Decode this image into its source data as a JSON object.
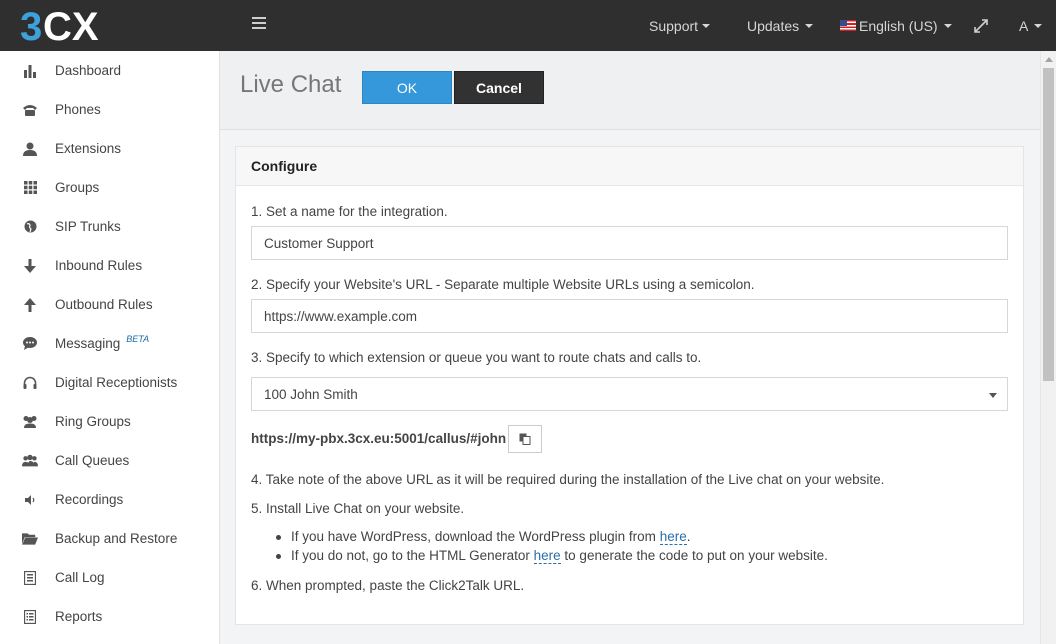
{
  "topbar": {
    "logo_text": "3CX",
    "nav": {
      "support": "Support",
      "updates": "Updates",
      "language": "English (US)",
      "user": "A"
    }
  },
  "sidebar": {
    "items": [
      {
        "label": "Dashboard",
        "icon": "bar-chart-icon"
      },
      {
        "label": "Phones",
        "icon": "phone-icon"
      },
      {
        "label": "Extensions",
        "icon": "user-icon"
      },
      {
        "label": "Groups",
        "icon": "grid-icon"
      },
      {
        "label": "SIP Trunks",
        "icon": "globe-icon"
      },
      {
        "label": "Inbound Rules",
        "icon": "arrow-down-icon"
      },
      {
        "label": "Outbound Rules",
        "icon": "arrow-up-icon"
      },
      {
        "label": "Messaging",
        "icon": "chat-bubble-icon",
        "badge": "BETA"
      },
      {
        "label": "Digital Receptionists",
        "icon": "headset-icon"
      },
      {
        "label": "Ring Groups",
        "icon": "users-icon"
      },
      {
        "label": "Call Queues",
        "icon": "queue-users-icon"
      },
      {
        "label": "Recordings",
        "icon": "speaker-icon"
      },
      {
        "label": "Backup and Restore",
        "icon": "folder-open-icon"
      },
      {
        "label": "Call Log",
        "icon": "list-doc-icon"
      },
      {
        "label": "Reports",
        "icon": "report-icon"
      }
    ]
  },
  "header": {
    "title": "Live Chat",
    "ok_label": "OK",
    "cancel_label": "Cancel"
  },
  "panel": {
    "title": "Configure",
    "step1": "1. Set a name for the integration.",
    "name_value": "Customer Support",
    "step2": "2. Specify your Website's URL - Separate multiple Website URLs using a semicolon.",
    "url_value": "https://www.example.com",
    "step3": "3. Specify to which extension or queue you want to route chats and calls to.",
    "route_value": "100 John Smith",
    "click2talk_url": "https://my-pbx.3cx.eu:5001/callus/#john",
    "step4": "4. Take note of the above URL as it will be required during the installation of the Live chat on your website.",
    "step5": "5. Install Live Chat on your website.",
    "bullet1_pre": "If you have WordPress, download the WordPress plugin from ",
    "bullet1_link": "here",
    "bullet1_post": ".",
    "bullet2_pre": "If you do not, go to the HTML Generator ",
    "bullet2_link": "here",
    "bullet2_post": " to generate the code to put on your website.",
    "step6": "6. When prompted, paste the Click2Talk URL."
  },
  "colors": {
    "topbar": "#2f2f2f",
    "primary": "#3498db",
    "cancel": "#323232",
    "link": "#2a6fa8"
  }
}
